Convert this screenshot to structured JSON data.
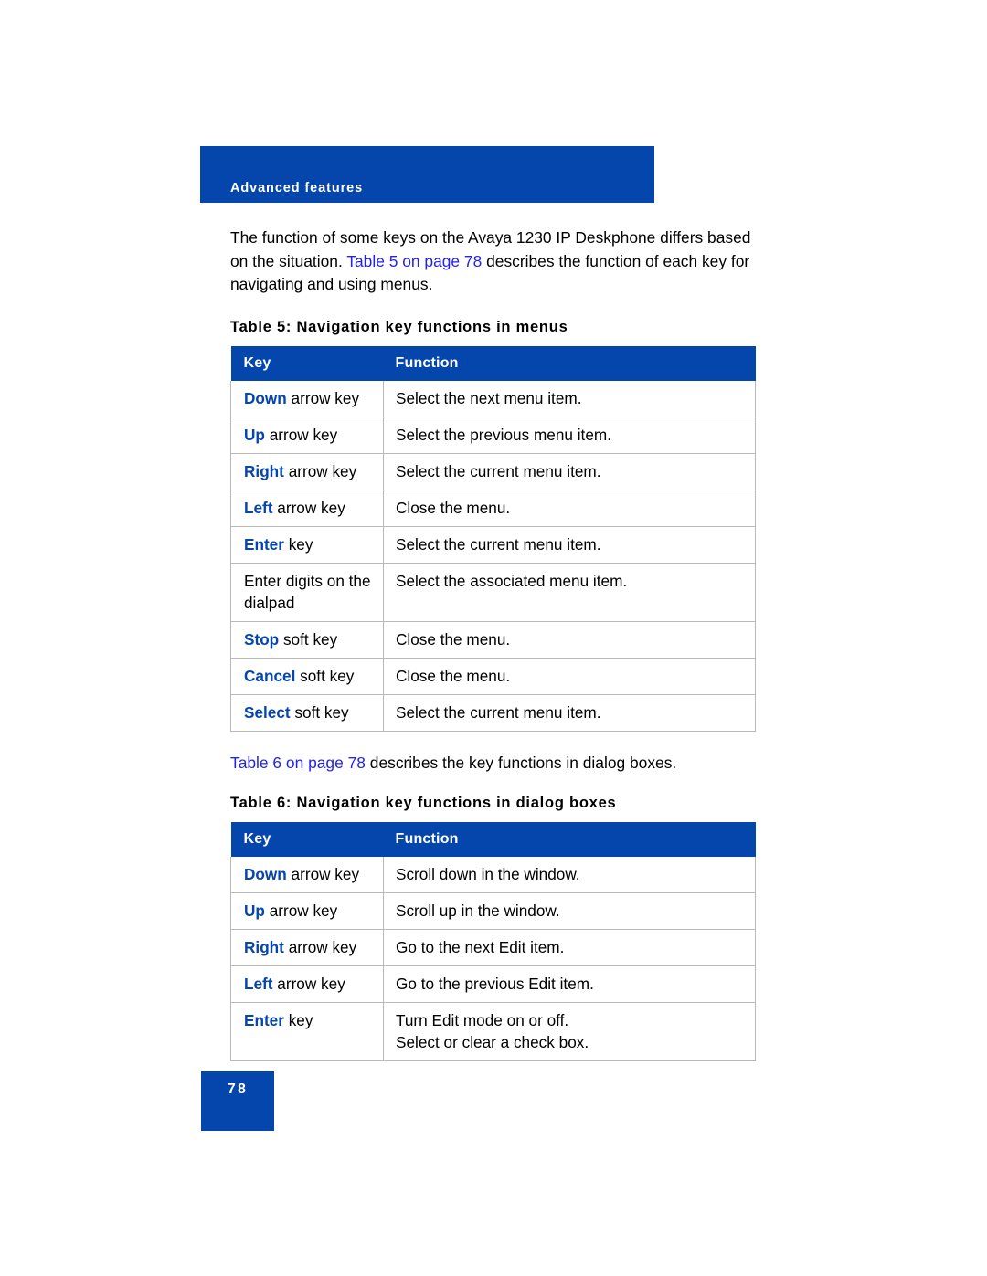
{
  "header": {
    "running_title": "Advanced features"
  },
  "intro": {
    "before_link": "The function of some keys on the Avaya 1230 IP Deskphone differs based on the situation. ",
    "link": "Table 5 on page 78",
    "after_link": " describes the function of each key for navigating and using menus."
  },
  "table5": {
    "caption": "Table 5: Navigation key functions in menus",
    "columns": [
      "Key",
      "Function"
    ],
    "rows": [
      {
        "key_bold": "Down",
        "key_rest": " arrow key",
        "function": "Select the next menu item."
      },
      {
        "key_bold": "Up",
        "key_rest": " arrow key",
        "function": "Select the previous menu item."
      },
      {
        "key_bold": "Right",
        "key_rest": " arrow key",
        "function": "Select the current menu item."
      },
      {
        "key_bold": "Left",
        "key_rest": " arrow key",
        "function": "Close the menu."
      },
      {
        "key_bold": "Enter",
        "key_rest": " key",
        "function": "Select the current menu item."
      },
      {
        "key_bold": "",
        "key_rest": "Enter digits on the dialpad",
        "function": "Select the associated menu item."
      },
      {
        "key_bold": "Stop",
        "key_rest": " soft key",
        "function": "Close the menu."
      },
      {
        "key_bold": "Cancel",
        "key_rest": " soft key",
        "function": "Close the menu."
      },
      {
        "key_bold": "Select",
        "key_rest": " soft key",
        "function": "Select the current menu item."
      }
    ]
  },
  "between_tables": {
    "link": "Table 6 on page 78",
    "after_link": " describes the key functions in dialog boxes."
  },
  "table6": {
    "caption": "Table 6: Navigation key functions in dialog boxes",
    "columns": [
      "Key",
      "Function"
    ],
    "rows": [
      {
        "key_bold": "Down",
        "key_rest": " arrow key",
        "function": "Scroll down in the window.",
        "function_line2": ""
      },
      {
        "key_bold": "Up",
        "key_rest": " arrow key",
        "function": "Scroll up in the window.",
        "function_line2": ""
      },
      {
        "key_bold": "Right",
        "key_rest": " arrow key",
        "function": "Go to the next Edit item.",
        "function_line2": ""
      },
      {
        "key_bold": "Left",
        "key_rest": " arrow key",
        "function": "Go to the previous Edit item.",
        "function_line2": ""
      },
      {
        "key_bold": "Enter",
        "key_rest": " key",
        "function": "Turn Edit mode on or off.",
        "function_line2": "Select or clear a check box."
      }
    ]
  },
  "footer": {
    "page_number": "78"
  },
  "colors": {
    "brand_blue": "#0546AD",
    "link_blue": "#2222EE",
    "rule_gray": "#b9b9b9"
  }
}
